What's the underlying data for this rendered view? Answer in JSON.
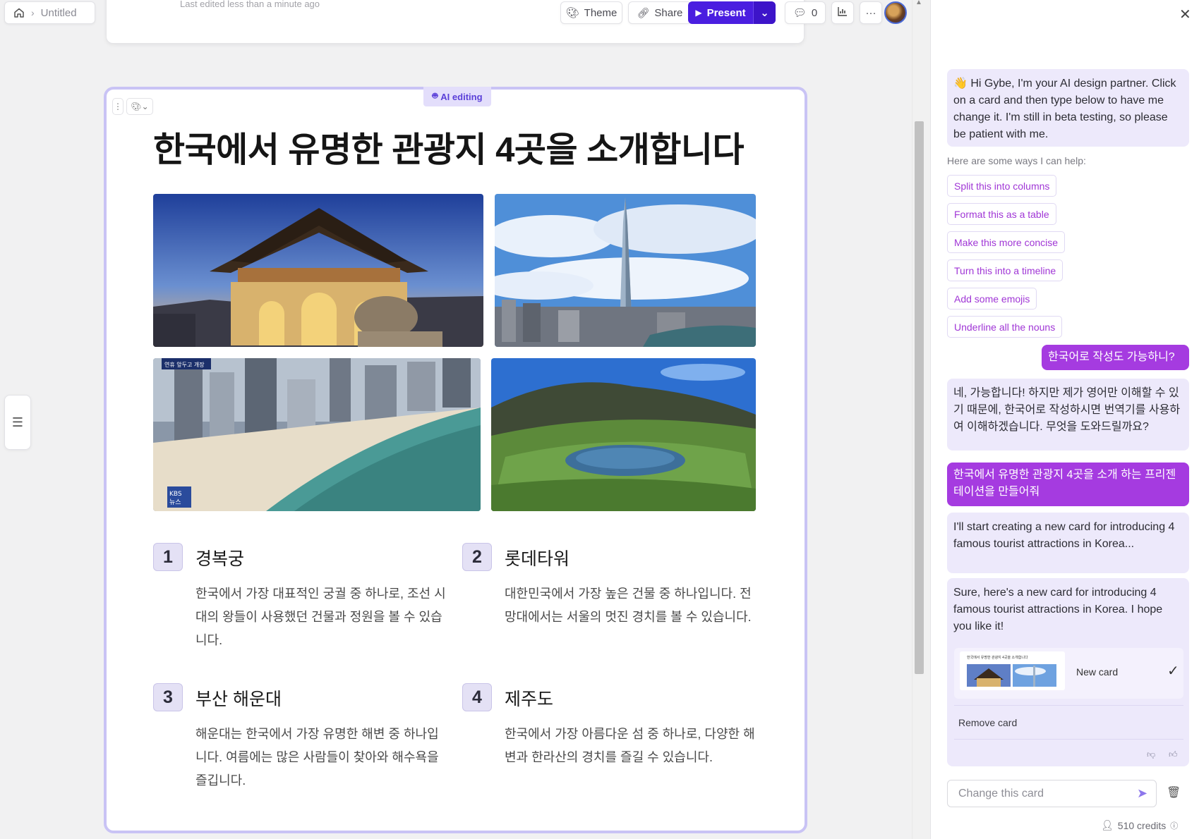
{
  "header": {
    "last_edited": "Last edited less than a minute ago",
    "breadcrumb_doc": "Untitled",
    "theme_label": "Theme",
    "share_label": "Share",
    "present_label": "Present",
    "comments_count": "0",
    "more_label": "···"
  },
  "slide": {
    "badge": "AI editing",
    "title": "한국에서 유명한 관광지 4곳을 소개합니다",
    "items": [
      {
        "num": "1",
        "name": "경복궁",
        "desc": "한국에서 가장 대표적인 궁궐 중 하나로, 조선 시대의 왕들이 사용했던 건물과 정원을 볼 수 있습니다."
      },
      {
        "num": "2",
        "name": "롯데타워",
        "desc": "대한민국에서 가장 높은 건물 중 하나입니다. 전망대에서는 서울의 멋진 경치를 볼 수 있습니다."
      },
      {
        "num": "3",
        "name": "부산 해운대",
        "desc": "해운대는 한국에서 가장 유명한 해변 중 하나입니다. 여름에는 많은 사람들이 찾아와 해수욕을 즐깁니다."
      },
      {
        "num": "4",
        "name": "제주도",
        "desc": "한국에서 가장 아름다운 섬 중 하나로, 다양한 해변과 한라산의 경치를 즐길 수 있습니다."
      }
    ],
    "photo_overlay_tv": "KBS 뉴스",
    "photo_overlay_caption": "연휴 앞두고 개장"
  },
  "panel": {
    "greeting": "👋 Hi Gybe, I'm your AI design partner. Click on a card and then type below to have me change it. I'm still in beta testing, so please be patient with me.",
    "help_title": "Here are some ways I can help:",
    "suggestions": [
      "Split this into columns",
      "Format this as a table",
      "Make this more concise",
      "Turn this into a timeline",
      "Add some emojis",
      "Underline all the nouns"
    ],
    "user_msg_1": "한국어로 작성도 가능하니?",
    "ai_reply_1": "네, 가능합니다! 하지만 제가 영어만 이해할 수 있기 때문에, 한국어로 작성하시면 번역기를 사용하여 이해하겠습니다. 무엇을 도와드릴까요?",
    "user_msg_2": "한국에서 유명한 관광지 4곳을 소개 하는 프리젠테이션을 만들어줘",
    "ai_reply_2": "I'll start creating a new card for introducing 4 famous tourist attractions in Korea...",
    "ai_reply_3": "Sure, here's a new card for introducing 4 famous tourist attractions in Korea. I hope you like it!",
    "new_card_label": "New card",
    "thumb_title": "한국에서 유명한 관광지 4곳을 소개합니다",
    "remove_card": "Remove card",
    "input_placeholder": "Change this card",
    "credits": "510 credits"
  },
  "colors": {
    "accent": "#4a1ee0",
    "user_bubble": "#a53be0",
    "ai_bubble": "#ede9fb",
    "slide_border": "#c9c3f5"
  }
}
